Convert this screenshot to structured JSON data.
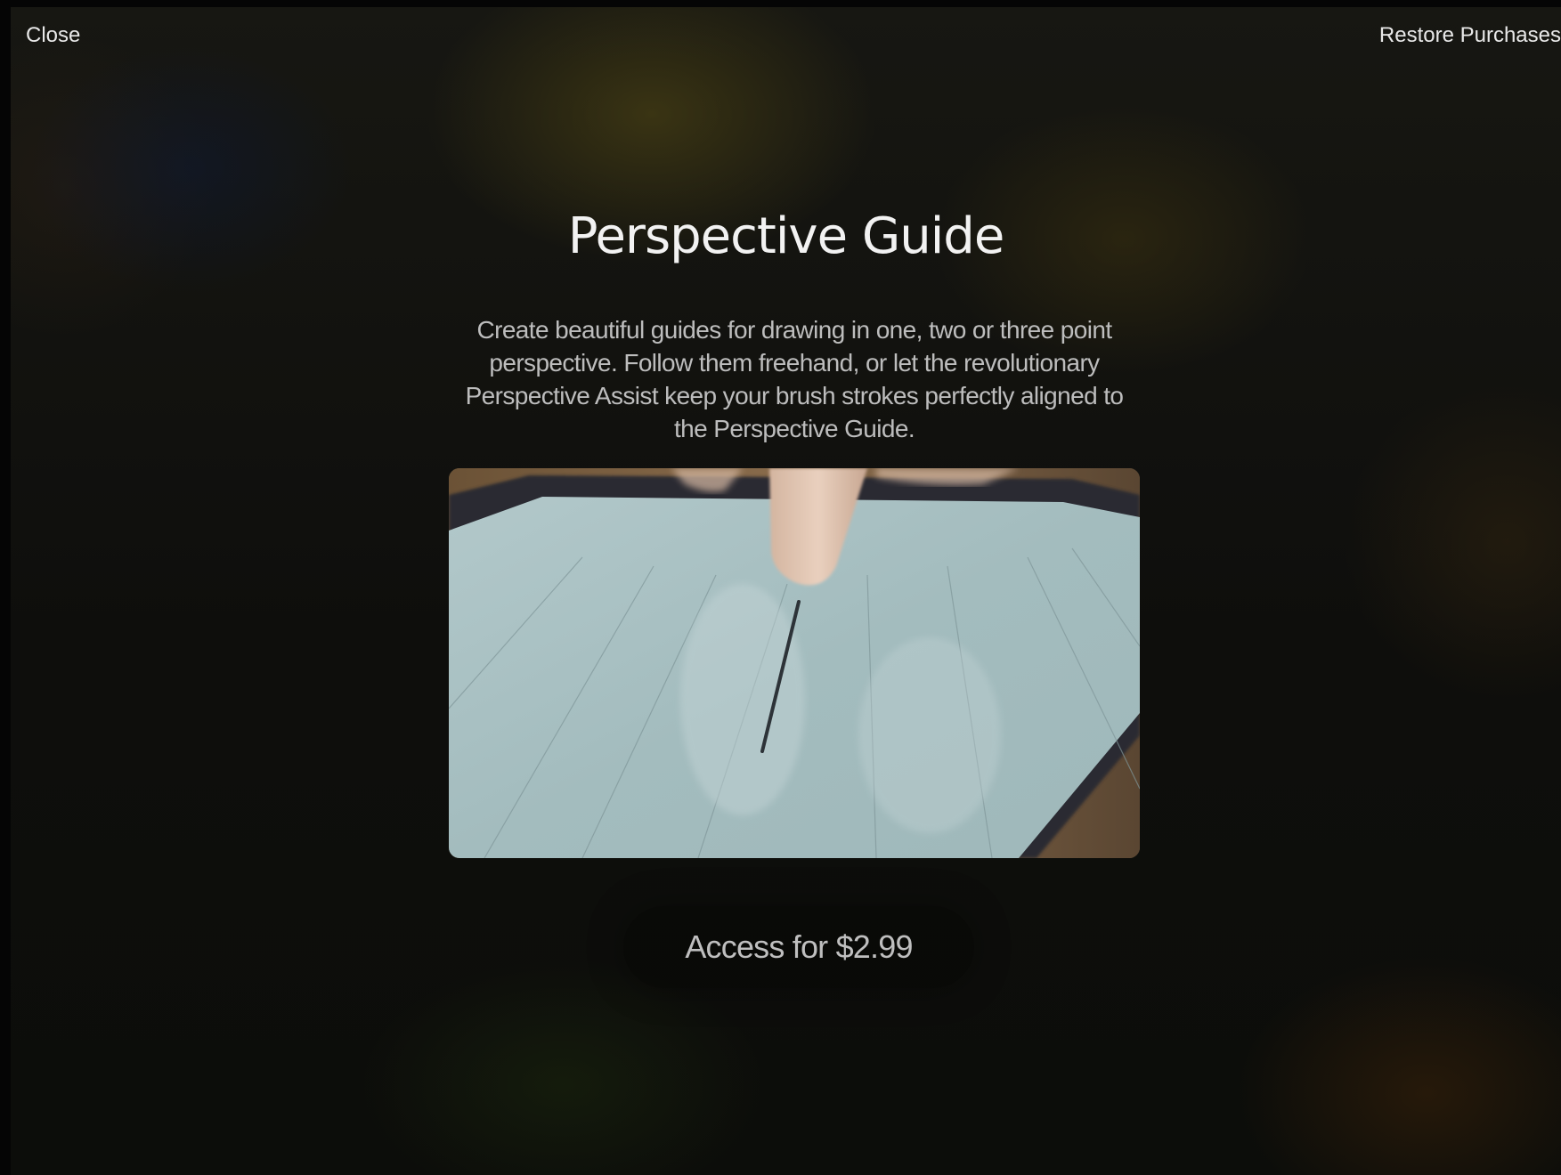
{
  "nav": {
    "close_label": "Close",
    "restore_label": "Restore Purchases"
  },
  "feature": {
    "title": "Perspective Guide",
    "description": "Create beautiful guides for drawing in one, two or three point perspective. Follow them freehand, or let the revolutionary Perspective Assist keep your brush strokes perfectly aligned to the Perspective Guide."
  },
  "purchase": {
    "button_label": "Access for $2.99"
  },
  "colors": {
    "text_primary": "#f2f2f2",
    "text_secondary": "#bdbdbd",
    "screen_tint": "#a7bec0"
  }
}
